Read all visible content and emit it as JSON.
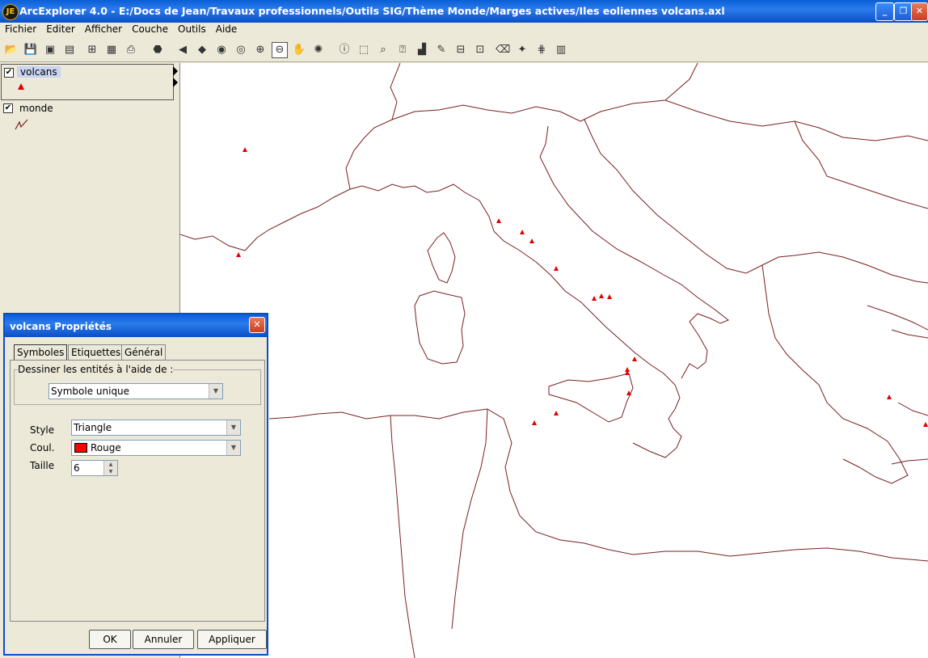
{
  "window": {
    "title": "ArcExplorer 4.0 - E:/Docs de Jean/Travaux professionnels/Outils SIG/Thème Monde/Marges actives/Iles eoliennes volcans.axl",
    "app_icon_letter": "JE"
  },
  "menu": [
    "Fichier",
    "Editer",
    "Afficher",
    "Couche",
    "Outils",
    "Aide"
  ],
  "toc": {
    "layers": [
      {
        "name": "volcans",
        "checked": true,
        "symbol": "red-triangle"
      },
      {
        "name": "monde",
        "checked": true,
        "symbol": "line"
      }
    ]
  },
  "dialog": {
    "title": "volcans Propriétés",
    "tabs": [
      "Symboles",
      "Etiquettes",
      "Général"
    ],
    "group_label": "Dessiner les entités à l'aide de :",
    "render_mode": "Symbole unique",
    "style_label": "Style",
    "style_value": "Triangle",
    "color_label": "Coul.",
    "color_value": "Rouge",
    "color_hex": "#ff0000",
    "size_label": "Taille",
    "size_value": "6",
    "buttons": {
      "ok": "OK",
      "cancel": "Annuler",
      "apply": "Appliquer"
    }
  },
  "colors": {
    "title_blue": "#0a4fc8",
    "coastline": "#7a1f1f",
    "volcano": "#e00000"
  }
}
